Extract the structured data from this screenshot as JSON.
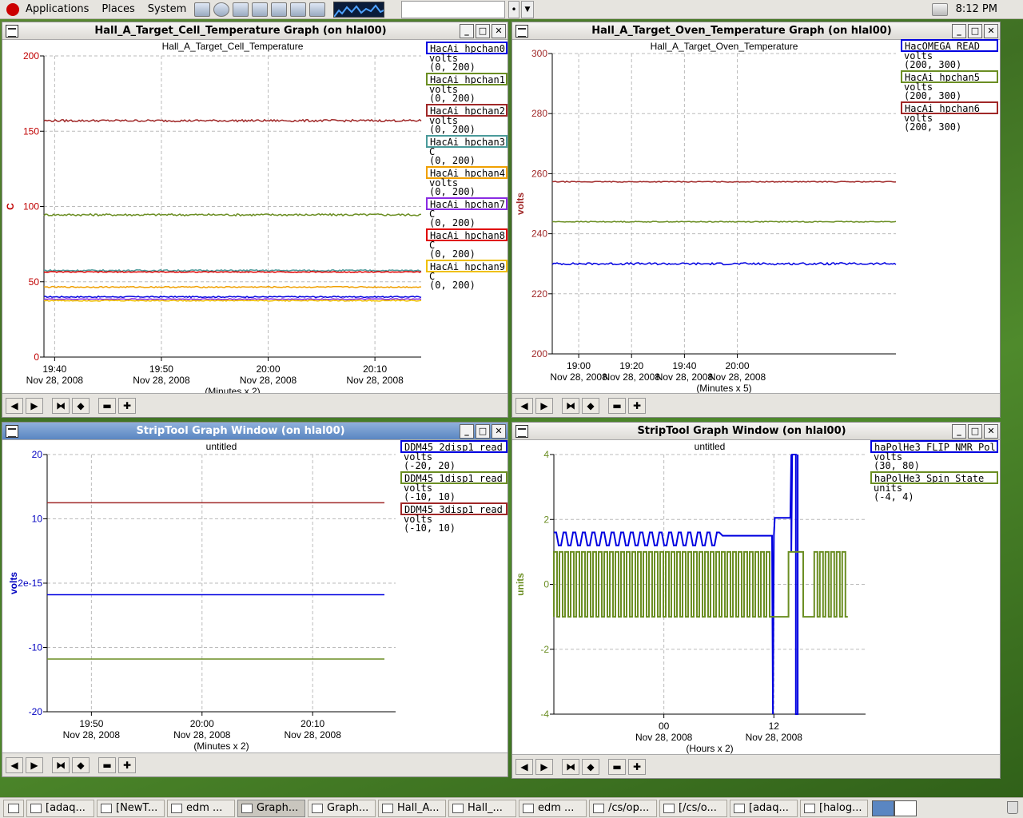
{
  "top_panel": {
    "menus": [
      "Applications",
      "Places",
      "System"
    ],
    "clock": "8:12 PM"
  },
  "windows": {
    "cell": {
      "title": "Hall_A_Target_Cell_Temperature Graph (on hlal00)",
      "chart_title": "Hall_A_Target_Cell_Temperature",
      "controls": [
        "◀",
        "▶",
        "⧓",
        "◆",
        "▬",
        "✚"
      ]
    },
    "oven": {
      "title": "Hall_A_Target_Oven_Temperature Graph (on hlal00)",
      "chart_title": "Hall_A_Target_Oven_Temperature"
    },
    "strip": {
      "title": "StripTool Graph Window (on hlal00)",
      "chart_title": "untitled"
    },
    "nmr": {
      "title": "StripTool Graph Window (on hlal00)",
      "chart_title": "untitled"
    }
  },
  "chart_data": [
    {
      "type": "line",
      "title": "Hall_A_Target_Cell_Temperature",
      "ylabel": "C",
      "ylabel_color": "#c00000",
      "ylim": [
        0,
        200
      ],
      "yticks": [
        0,
        50,
        100,
        150,
        200
      ],
      "xlim": [
        -3,
        103
      ],
      "xticks": [
        {
          "x": 0,
          "time": "19:40",
          "date": "Nov 28, 2008"
        },
        {
          "x": 30,
          "time": "19:50",
          "date": "Nov 28, 2008"
        },
        {
          "x": 60,
          "time": "20:00",
          "date": "Nov 28, 2008"
        },
        {
          "x": 90,
          "time": "20:10",
          "date": "Nov 28, 2008"
        }
      ],
      "xnote": "(Minutes x 2)",
      "grid": true,
      "series": [
        {
          "name": "HacAi_hpchan0",
          "units": "volts",
          "range": "(0, 200)",
          "color": "#0000e0",
          "level": 40,
          "noise": 0.4
        },
        {
          "name": "HacAi_hpchan1",
          "units": "volts",
          "range": "(0, 200)",
          "color": "#6b8e23",
          "level": 94.5,
          "noise": 0.7
        },
        {
          "name": "HacAi_hpchan2",
          "units": "volts",
          "range": "(0, 200)",
          "color": "#a02828",
          "level": 157,
          "noise": 0.7
        },
        {
          "name": "HacAi_hpchan3",
          "units": "C",
          "range": "(0, 200)",
          "color": "#4a9a9a",
          "level": 57.5,
          "noise": 0.5
        },
        {
          "name": "HacAi_hpchan4",
          "units": "volts",
          "range": "(0, 200)",
          "color": "#f0a000",
          "level": 46.5,
          "noise": 0.4
        },
        {
          "name": "HacAi_hpchan7",
          "units": "C",
          "range": "(0, 200)",
          "color": "#8a2be2",
          "level": 38.5,
          "noise": 0.3
        },
        {
          "name": "HacAi_hpchan8",
          "units": "C",
          "range": "(0, 200)",
          "color": "#e00000",
          "level": 56.5,
          "noise": 0.3
        },
        {
          "name": "HacAi_hpchan9",
          "units": "C",
          "range": "(0, 200)",
          "color": "#f0c000",
          "level": 37.5,
          "noise": 0.4
        }
      ]
    },
    {
      "type": "line",
      "title": "Hall_A_Target_Oven_Temperature",
      "ylabel": "volts",
      "ylabel_color": "#a02828",
      "ylim": [
        200,
        300
      ],
      "yticks": [
        200,
        220,
        240,
        260,
        280,
        300
      ],
      "xlim": [
        -10,
        120
      ],
      "xticks": [
        {
          "x": 0,
          "time": "19:00",
          "date": "Nov 28, 2008"
        },
        {
          "x": 20,
          "time": "19:20",
          "date": "Nov 28, 2008"
        },
        {
          "x": 40,
          "time": "19:40",
          "date": "Nov 28, 2008"
        },
        {
          "x": 60,
          "time": "20:00",
          "date": "Nov 28, 2008"
        }
      ],
      "xnote": "(Minutes x 5)",
      "grid": true,
      "series": [
        {
          "name": "HacOMEGA_READ",
          "units": "volts",
          "range": "(200, 300)",
          "color": "#0000e0",
          "level": 230,
          "noise": 0.35
        },
        {
          "name": "HacAi_hpchan5",
          "units": "volts",
          "range": "(200, 300)",
          "color": "#6b8e23",
          "level": 244,
          "noise": 0.15
        },
        {
          "name": "HacAi_hpchan6",
          "units": "volts",
          "range": "(200, 300)",
          "color": "#a02828",
          "level": 257.3,
          "noise": 0.15
        }
      ]
    },
    {
      "type": "line",
      "title": "untitled",
      "ylabel": "volts",
      "ylabel_color": "#0000c0",
      "ylim": [
        -20,
        20
      ],
      "yticks": [
        "20",
        "10",
        "2e-15",
        "-10",
        "-20"
      ],
      "xlim": [
        -8,
        55
      ],
      "xticks": [
        {
          "x": 0,
          "time": "19:50",
          "date": "Nov 28, 2008"
        },
        {
          "x": 20,
          "time": "20:00",
          "date": "Nov 28, 2008"
        },
        {
          "x": 40,
          "time": "20:10",
          "date": "Nov 28, 2008"
        }
      ],
      "xnote": "(Minutes x 2)",
      "grid": true,
      "series": [
        {
          "name": "DDM45_2disp1_read",
          "units": "volts",
          "range": "(-20, 20)",
          "color": "#0000e0",
          "level": -1.8
        },
        {
          "name": "DDM45_1disp1_read",
          "units": "volts",
          "range": "(-10, 10)",
          "color": "#6b8e23",
          "level": -11.8
        },
        {
          "name": "DDM45_3disp1_read",
          "units": "volts",
          "range": "(-10, 10)",
          "color": "#a02828",
          "level": 12.5
        }
      ]
    },
    {
      "type": "line",
      "title": "untitled",
      "ylabel": "units",
      "ylabel_color": "#6b8e23",
      "ylim": [
        -4,
        4
      ],
      "yticks": [
        -4,
        -2,
        0,
        2,
        4
      ],
      "xlim": [
        -6,
        11
      ],
      "xticks": [
        {
          "x": 0,
          "time": "00",
          "date": "Nov 28, 2008"
        },
        {
          "x": 6,
          "time": "12",
          "date": "Nov 28, 2008"
        }
      ],
      "xnote": "(Hours x 2)",
      "grid": true,
      "series": [
        {
          "name": "haPolHe3_FLIP_NMR_Pol",
          "units": "volts",
          "range": "(30, 80)",
          "color": "#0000e0"
        },
        {
          "name": "haPolHe3_Spin_State",
          "units": "units",
          "range": "(-4, 4)",
          "color": "#6b8e23"
        }
      ]
    }
  ],
  "taskbar": {
    "items": [
      "[adaq...",
      "[NewT...",
      "edm ...",
      "Graph...",
      "Graph...",
      "Hall_A...",
      "Hall_...",
      "edm ...",
      "/cs/op...",
      "[/cs/o...",
      "[adaq...",
      "[halog..."
    ]
  }
}
